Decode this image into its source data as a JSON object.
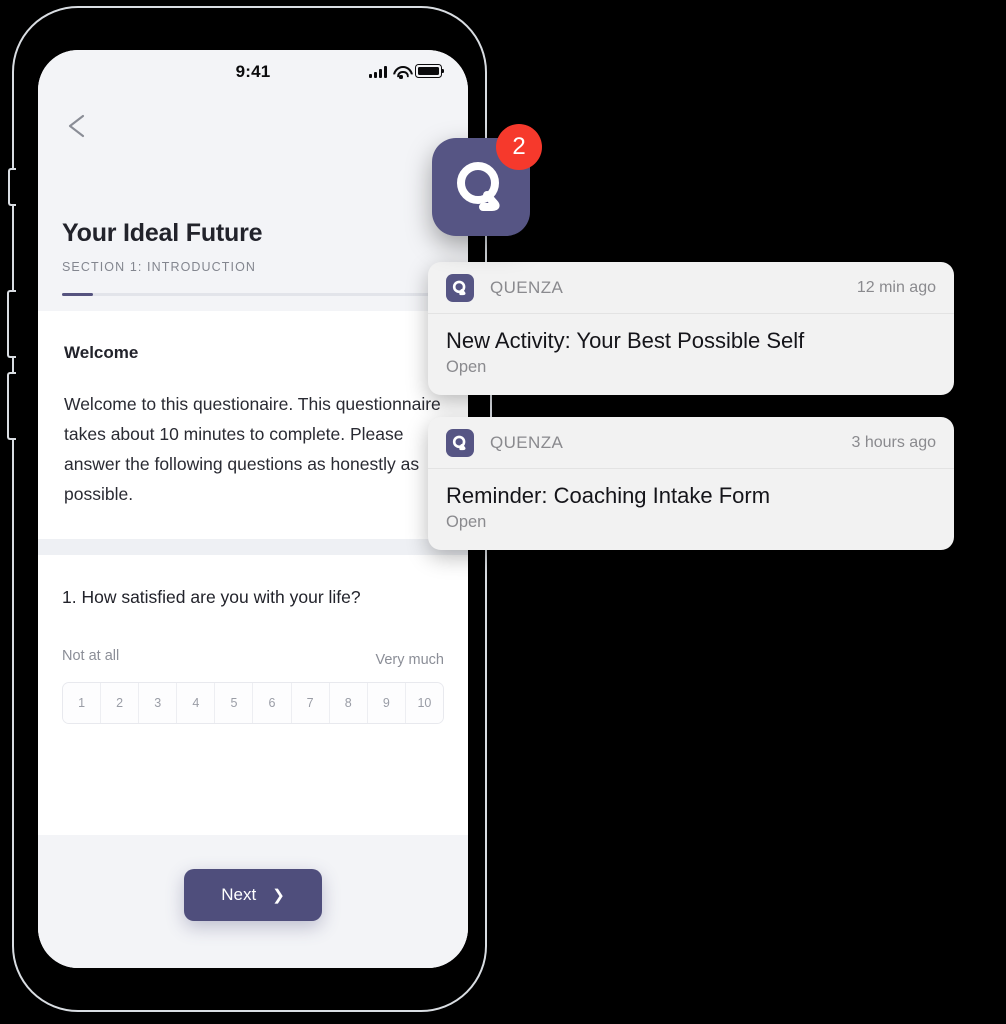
{
  "phone": {
    "status_bar": {
      "time": "9:41",
      "signal_icon": "cellular-bars-icon",
      "wifi_icon": "wifi-icon",
      "battery_icon": "battery-full-icon"
    },
    "header": {
      "back_icon": "chevron-left-icon",
      "title": "Your Ideal Future",
      "section": "SECTION 1: INTRODUCTION",
      "progress_percent": 8
    },
    "welcome": {
      "heading": "Welcome",
      "body": "Welcome to this questionaire. This questionnaire takes about 10 minutes to complete. Please answer the following questions as honestly as possible."
    },
    "question": {
      "text": "1. How satisfied are you with your life?",
      "scale_low_label": "Not at all",
      "scale_high_label": "Very much",
      "scale_options": [
        "1",
        "2",
        "3",
        "4",
        "5",
        "6",
        "7",
        "8",
        "9",
        "10"
      ]
    },
    "footer": {
      "next_label": "Next",
      "next_chevron_icon": "chevron-right-icon"
    }
  },
  "app_icon": {
    "name": "quenza-app-icon",
    "badge_count": "2",
    "badge_color": "#f6392c",
    "brand_color": "#565584"
  },
  "notifications": [
    {
      "app_name": "QUENZA",
      "time": "12 min ago",
      "title": "New Activity: Your Best Possible Self",
      "action": "Open",
      "icon": "quenza-icon"
    },
    {
      "app_name": "QUENZA",
      "time": "3 hours ago",
      "title": "Reminder: Coaching Intake Form",
      "action": "Open",
      "icon": "quenza-icon"
    }
  ]
}
